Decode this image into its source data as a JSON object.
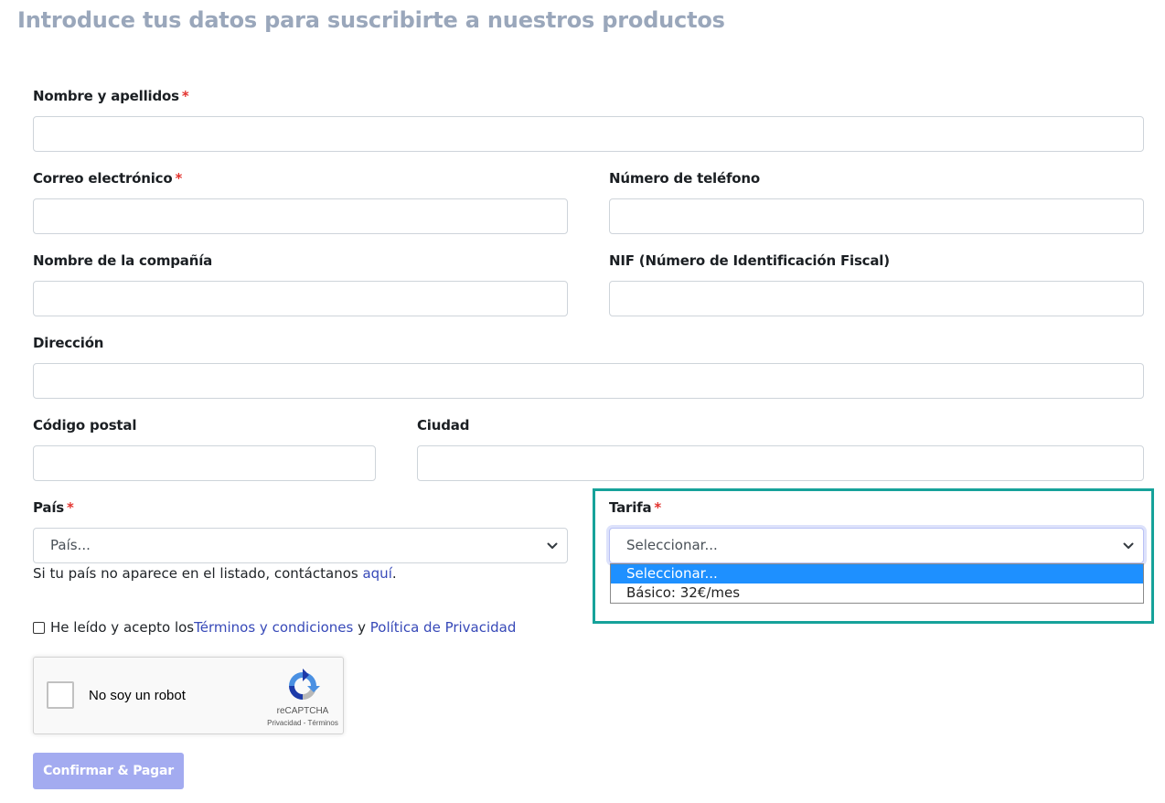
{
  "page": {
    "title": "Introduce tus datos para suscribirte a nuestros productos"
  },
  "form": {
    "required_mark": "*",
    "full_name": {
      "label": "Nombre y apellidos",
      "value": ""
    },
    "email": {
      "label": "Correo electrónico",
      "value": ""
    },
    "phone": {
      "label": "Número de teléfono",
      "value": ""
    },
    "company": {
      "label": "Nombre de la compañía",
      "value": ""
    },
    "nif": {
      "label": "NIF (Número de Identificación Fiscal)",
      "value": ""
    },
    "address": {
      "label": "Dirección",
      "value": ""
    },
    "postal_code": {
      "label": "Código postal",
      "value": ""
    },
    "city": {
      "label": "Ciudad",
      "value": ""
    },
    "country": {
      "label": "País",
      "selected": "País...",
      "help_text": "Si tu país no aparece en el listado, contáctanos ",
      "help_link": "aquí",
      "help_end": "."
    },
    "plan": {
      "label": "Tarifa",
      "selected": "Seleccionar...",
      "options": [
        "Seleccionar...",
        "Básico: 32€/mes"
      ]
    },
    "terms": {
      "text_before": "He leído y acepto los ",
      "terms_link": "Términos y condiciones",
      "text_middle": " y ",
      "privacy_link": "Política de Privacidad",
      "checked": false
    },
    "captcha": {
      "label": "No soy un robot",
      "brand": "reCAPTCHA",
      "privacy": "Privacidad",
      "separator": " - ",
      "terms": "Términos"
    },
    "submit_label": "Confirmar & Pagar"
  },
  "colors": {
    "title": "#9aa7bb",
    "required": "#e3342f",
    "link": "#3749b8",
    "highlight_border": "#16a29a",
    "option_selected_bg": "#1e90ff",
    "submit_bg": "#a3abf0"
  },
  "icons": {
    "select_arrow": "chevron-down-icon",
    "captcha_logo": "recaptcha-icon"
  }
}
